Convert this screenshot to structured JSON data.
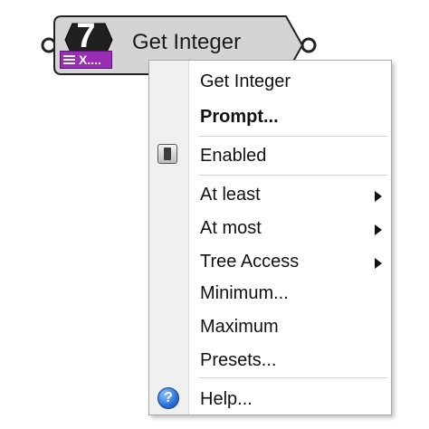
{
  "component": {
    "icon_digit": "7",
    "tag_text": "X....",
    "title": "Get Integer"
  },
  "menu": {
    "header": "Get Integer",
    "items": [
      {
        "label": "Prompt...",
        "bold": true
      },
      {
        "label": "Enabled",
        "icon": "toggle-icon"
      },
      {
        "label": "At least",
        "submenu": true
      },
      {
        "label": "At most",
        "submenu": true
      },
      {
        "label": "Tree Access",
        "submenu": true
      },
      {
        "label": "Minimum..."
      },
      {
        "label": "Maximum"
      },
      {
        "label": "Presets..."
      },
      {
        "label": "Help...",
        "icon": "help-icon"
      }
    ]
  },
  "colors": {
    "tag_purple": "#9b2cb5",
    "node_body": "#d4d4d4",
    "menu_gutter": "#f0f0f0"
  }
}
